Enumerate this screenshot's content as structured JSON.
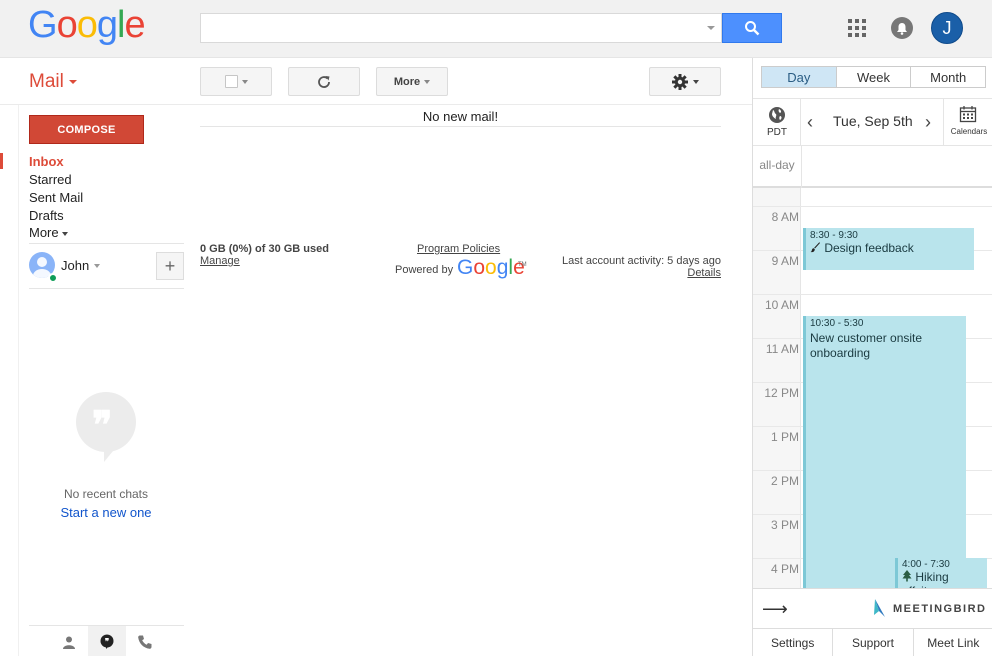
{
  "header": {
    "logo_letters": [
      "G",
      "o",
      "o",
      "g",
      "l",
      "e"
    ],
    "logo_colors": [
      "#4285f4",
      "#ea4335",
      "#fbbc05",
      "#4285f4",
      "#34a853",
      "#ea4335"
    ],
    "search_placeholder": "",
    "avatar_initial": "J"
  },
  "nav": {
    "mail_label": "Mail",
    "compose_label": "COMPOSE",
    "items": [
      {
        "label": "Inbox"
      },
      {
        "label": "Starred"
      },
      {
        "label": "Sent Mail"
      },
      {
        "label": "Drafts"
      },
      {
        "label": "More"
      }
    ]
  },
  "hangouts": {
    "user_name": "John",
    "add_label": "+",
    "no_chats": "No recent chats",
    "start_new": "Start a new one"
  },
  "toolbar": {
    "more_label": "More"
  },
  "main": {
    "no_mail": "No new mail!",
    "storage": "0 GB (0%) of 30 GB used",
    "manage": "Manage",
    "policies": "Program Policies",
    "powered_by": "Powered by",
    "powered_tm": "TM",
    "activity": "Last account activity: 5 days ago",
    "details": "Details"
  },
  "calendar": {
    "views": [
      "Day",
      "Week",
      "Month"
    ],
    "active_view": "Day",
    "timezone": "PDT",
    "date": "Tue, Sep 5th",
    "calendars_label": "Calendars",
    "allday_label": "all-day",
    "hours": [
      "8 AM",
      "9 AM",
      "10 AM",
      "11 AM",
      "12 PM",
      "1 PM",
      "2 PM",
      "3 PM",
      "4 PM"
    ],
    "events": [
      {
        "time": "8:30 - 9:30",
        "title": "Design feedback",
        "icon": "paintbrush-icon"
      },
      {
        "time": "10:30 - 5:30",
        "title": "New customer onsite onboarding",
        "icon": ""
      },
      {
        "time": "4:00 - 7:30",
        "title": "Hiking offsite",
        "icon": "tree-icon"
      }
    ],
    "brand": "MEETINGBIRD",
    "links": [
      "Settings",
      "Support",
      "Meet Link"
    ]
  }
}
